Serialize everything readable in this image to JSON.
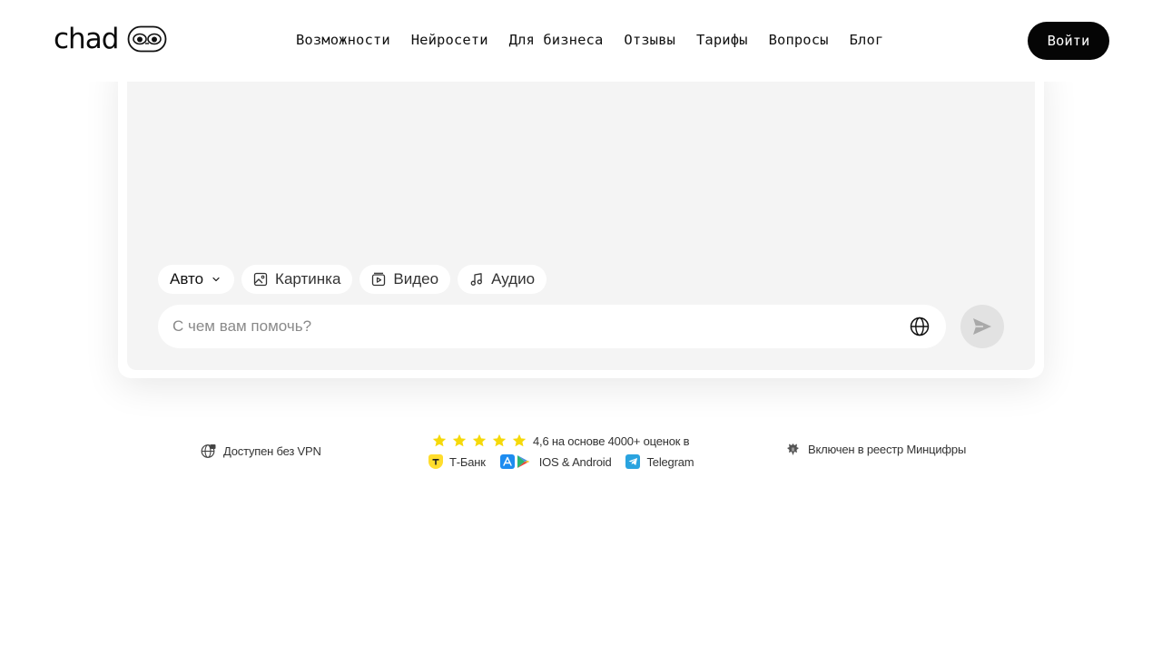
{
  "header": {
    "logo_text": "chad",
    "nav": [
      "Возможности",
      "Нейросети",
      "Для бизнеса",
      "Отзывы",
      "Тарифы",
      "Вопросы",
      "Блог"
    ],
    "login_label": "Войти"
  },
  "chat": {
    "modes": [
      {
        "label": "Авто",
        "icon": "chevron-down-icon"
      },
      {
        "label": "Картинка",
        "icon": "image-icon"
      },
      {
        "label": "Видео",
        "icon": "video-icon"
      },
      {
        "label": "Аудио",
        "icon": "music-note-icon"
      }
    ],
    "input_placeholder": "С чем вам помочь?",
    "input_value": "",
    "globe_icon": "globe-icon",
    "send_icon": "send-icon"
  },
  "info": {
    "vpn_text": "Доступен без VPN",
    "rating": {
      "stars": 5,
      "text": "4,6 на основе 4000+ оценок в",
      "tbank": "Т-Банк",
      "stores": "IOS & Android",
      "telegram": "Telegram"
    },
    "mincifry_text": "Включен в реестр Минцифры"
  },
  "colors": {
    "accent": "#050505",
    "card_bg": "#f4f4f4",
    "star": "#f5d90a",
    "send_bg": "#e2e2e2"
  }
}
